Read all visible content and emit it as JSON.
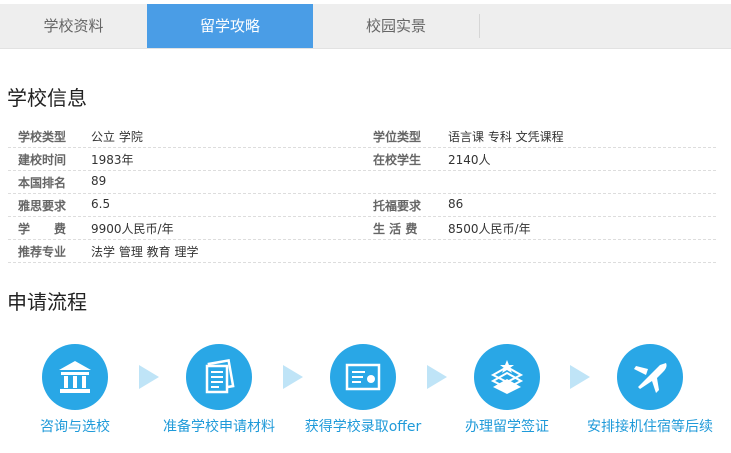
{
  "tabs": [
    {
      "label": "学校资料"
    },
    {
      "label": "留学攻略",
      "active": true
    },
    {
      "label": "校园实景"
    }
  ],
  "school_info": {
    "title": "学校信息",
    "rows": [
      {
        "label1": "学校类型",
        "value1": "公立 学院",
        "label2": "学位类型",
        "value2": "语言课 专科 文凭课程"
      },
      {
        "label1": "建校时间",
        "value1": "1983年",
        "label2": "在校学生",
        "value2": "2140人"
      },
      {
        "label1": "本国排名",
        "value1": "89",
        "label2": "",
        "value2": ""
      },
      {
        "label1": "雅思要求",
        "value1": "6.5",
        "label2": "托福要求",
        "value2": "86"
      },
      {
        "label1": "学　　费",
        "value1": "9900人民币/年",
        "label2": "生 活 费",
        "value2": "8500人民币/年"
      },
      {
        "label1": "推荐专业",
        "value1": "法学 管理 教育 理学",
        "label2": "",
        "value2": ""
      }
    ]
  },
  "process": {
    "title": "申请流程",
    "steps": [
      {
        "label": "咨询与选校",
        "icon": "school-building-icon"
      },
      {
        "label": "准备学校申请材料",
        "icon": "documents-icon"
      },
      {
        "label": "获得学校录取offer",
        "icon": "certificate-icon"
      },
      {
        "label": "办理留学签证",
        "icon": "passport-visa-icon"
      },
      {
        "label": "安排接机住宿等后续",
        "icon": "airplane-icon"
      }
    ]
  },
  "colors": {
    "tab_active": "#4a9de6",
    "circle": "#29a7e6",
    "step_label": "#1f9ad9",
    "arrow": "#bfe4f7"
  }
}
